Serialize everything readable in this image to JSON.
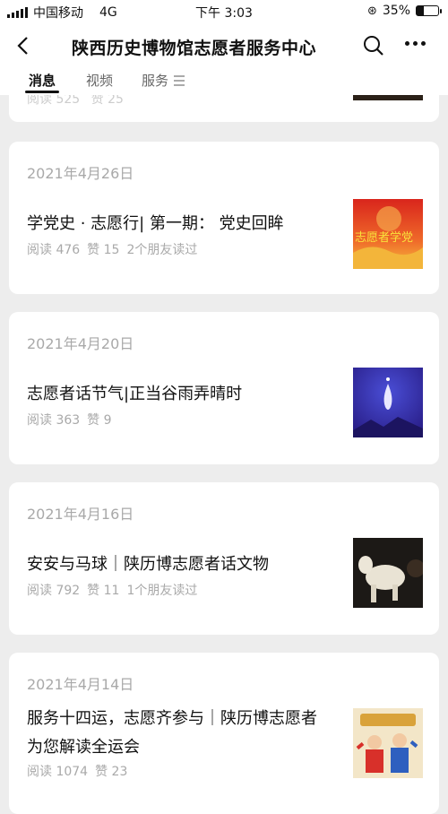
{
  "status": {
    "carrier": "中国移动",
    "network": "4G",
    "time": "下午 3:03",
    "battery_pct": "35%",
    "battery_level": 0.35
  },
  "nav": {
    "title": "陕西历史博物馆志愿者服务中心",
    "back_icon": "chevron-left-icon",
    "search_icon": "search-icon",
    "more_icon": "ellipsis-icon"
  },
  "tabs": [
    {
      "label": "消息",
      "active": true
    },
    {
      "label": "视频",
      "active": false
    },
    {
      "label": "服务",
      "active": false
    }
  ],
  "previous_article_stats": {
    "reads": "阅读 525",
    "likes": "赞 25"
  },
  "articles": [
    {
      "date": "2021年4月26日",
      "title": "学党史 · 志愿行| 第一期： 党史回眸",
      "reads": "阅读 476",
      "likes": "赞 15",
      "friends": "2个朋友读过",
      "thumb_text": "志愿者学党"
    },
    {
      "date": "2021年4月20日",
      "title": "志愿者话节气|正当谷雨弄晴时",
      "reads": "阅读 363",
      "likes": "赞 9",
      "friends": ""
    },
    {
      "date": "2021年4月16日",
      "title": "安安与马球｜陕历博志愿者话文物",
      "reads": "阅读 792",
      "likes": "赞 11",
      "friends": "1个朋友读过"
    },
    {
      "date": "2021年4月14日",
      "title": "服务十四运，志愿齐参与｜陕历博志愿者为您解读全运会",
      "reads": "阅读 1074",
      "likes": "赞 23",
      "friends": ""
    }
  ],
  "colors": {
    "accent": "#111111",
    "meta_gray": "#a9a9a9",
    "background": "#ededed"
  }
}
